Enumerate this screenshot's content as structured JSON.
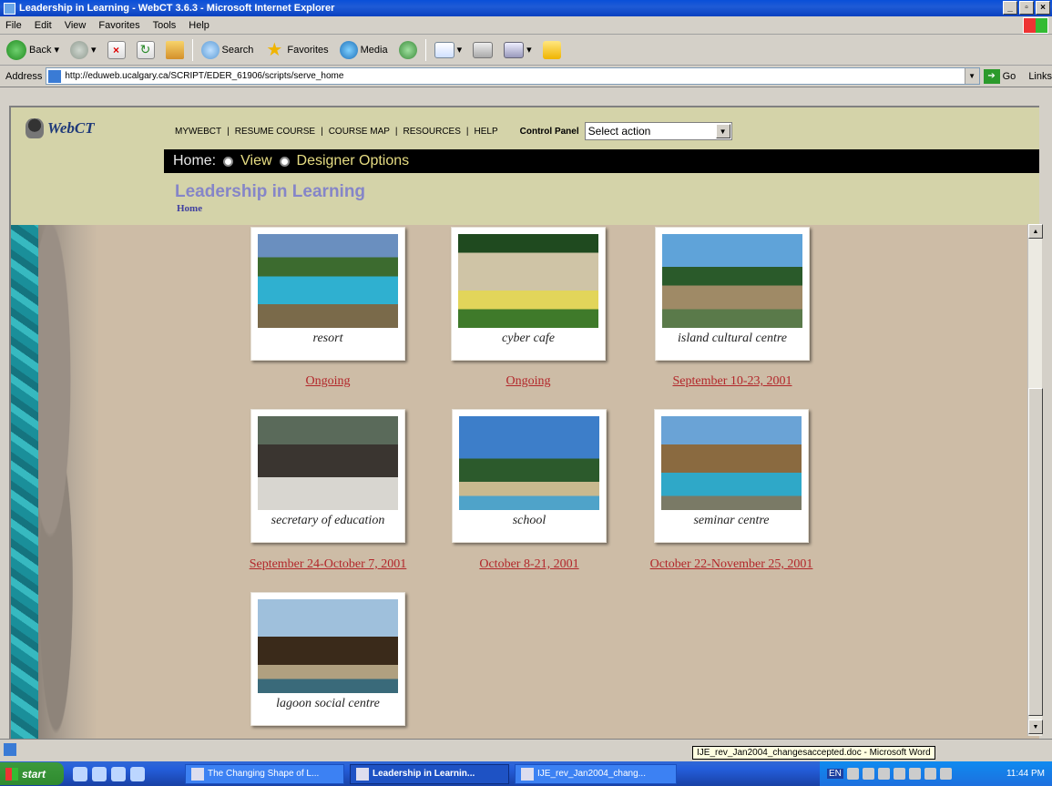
{
  "window": {
    "title": "Leadership in Learning - WebCT 3.6.3 - Microsoft Internet Explorer",
    "controls": [
      "_",
      "▫",
      "×"
    ]
  },
  "menu": [
    "File",
    "Edit",
    "View",
    "Favorites",
    "Tools",
    "Help"
  ],
  "toolbar": {
    "back": "Back",
    "search": "Search",
    "favorites": "Favorites",
    "media": "Media"
  },
  "address": {
    "label": "Address",
    "url": "http://eduweb.ucalgary.ca/SCRIPT/EDER_61906/scripts/serve_home",
    "go": "Go",
    "links": "Links"
  },
  "webct": {
    "logo": "WebCT",
    "nav": [
      "MYWEBCT",
      "RESUME COURSE",
      "COURSE MAP",
      "RESOURCES",
      "HELP"
    ],
    "control_panel_label": "Control Panel",
    "select_value": "Select action",
    "bar_home": "Home:",
    "bar_view": "View",
    "bar_designer": "Designer Options",
    "course_title": "Leadership in Learning",
    "breadcrumb": "Home"
  },
  "modules": [
    {
      "caption": "resort",
      "link": "Ongoing",
      "img": "resort"
    },
    {
      "caption": "cyber cafe",
      "link": "Ongoing",
      "img": "cafe"
    },
    {
      "caption": "island cultural centre",
      "link": "September 10-23, 2001",
      "img": "island"
    },
    {
      "caption": "secretary of education",
      "link": "September 24-October 7, 2001",
      "img": "secretary"
    },
    {
      "caption": "school",
      "link": "October 8-21, 2001",
      "img": "school"
    },
    {
      "caption": "seminar centre",
      "link": "October 22-November 25, 2001",
      "img": "seminar"
    },
    {
      "caption": "lagoon social centre",
      "link": "",
      "img": "lagoon"
    }
  ],
  "statusbar": {
    "tooltip": "IJE_rev_Jan2004_changesaccepted.doc - Microsoft Word"
  },
  "taskbar": {
    "start": "start",
    "tasks": [
      {
        "label": "The Changing Shape of L...",
        "active": false
      },
      {
        "label": "Leadership in Learnin...",
        "active": true
      },
      {
        "label": "IJE_rev_Jan2004_chang...",
        "active": false
      }
    ],
    "tray_lang": "EN",
    "clock": "11:44 PM"
  }
}
